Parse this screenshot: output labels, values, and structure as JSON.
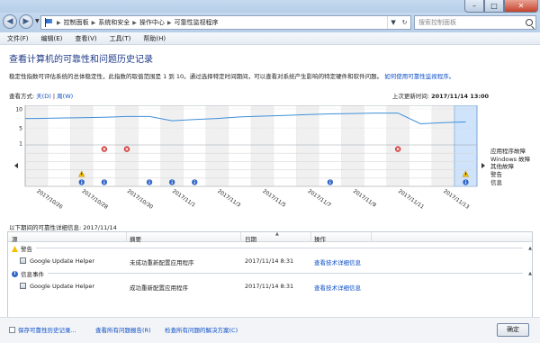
{
  "window": {
    "minimize": "–",
    "maximize": "□",
    "close": "✕"
  },
  "address": {
    "crumbs": [
      "控制面板",
      "系统和安全",
      "操作中心",
      "可靠性监视程序"
    ],
    "search_placeholder": "搜索控制面板",
    "icon": "flag-icon"
  },
  "menu": [
    "文件(F)",
    "编辑(E)",
    "查看(V)",
    "工具(T)",
    "帮助(H)"
  ],
  "page": {
    "title": "查看计算机的可靠性和问题历史记录",
    "description": "稳定性指数可评估系统的总体稳定性，此指数的取值范围是 1 到 10。通过选择特定时间期间，可以查看对系统产生影响的特定硬件和软件问题。",
    "help_link": "如何使用可靠性监视程序。",
    "view_label": "查看方式: ",
    "view_days": "天(D)",
    "view_sep": " | ",
    "view_weeks": "周(W)",
    "last_update_label": "上次更新时间: ",
    "last_update_value": "2017/11/14 13:00"
  },
  "chart_data": {
    "type": "line",
    "ylim": [
      1,
      10
    ],
    "yticks": [
      "10",
      "5",
      "1"
    ],
    "x": [
      "2017/10/26",
      "2017/10/27",
      "2017/10/28",
      "2017/10/29",
      "2017/10/30",
      "2017/10/31",
      "2017/11/1",
      "2017/11/2",
      "2017/11/3",
      "2017/11/4",
      "2017/11/5",
      "2017/11/6",
      "2017/11/7",
      "2017/11/8",
      "2017/11/9",
      "2017/11/10",
      "2017/11/11",
      "2017/11/12",
      "2017/11/13",
      "2017/11/14"
    ],
    "xticklabels": [
      "2017/10/26",
      "2017/10/28",
      "2017/10/30",
      "2017/11/1",
      "2017/11/3",
      "2017/11/5",
      "2017/11/7",
      "2017/11/9",
      "2017/11/11",
      "2017/11/13"
    ],
    "series": [
      {
        "values": [
          7.5,
          7.6,
          7.7,
          7.8,
          8.0,
          8.0,
          6.9,
          7.2,
          7.5,
          7.9,
          8.1,
          8.3,
          8.5,
          8.7,
          8.8,
          8.9,
          8.9,
          6.1,
          6.4,
          6.6
        ]
      }
    ],
    "selected": "2017/11/14",
    "rows": [
      "应用程序故障",
      "Windows 故障",
      "其他故障",
      "警告",
      "信息"
    ],
    "events": [
      {
        "date": "2017/10/29",
        "row": "应用程序故障",
        "icon": "error"
      },
      {
        "date": "2017/10/30",
        "row": "应用程序故障",
        "icon": "error"
      },
      {
        "date": "2017/11/11",
        "row": "应用程序故障",
        "icon": "error"
      },
      {
        "date": "2017/10/28",
        "row": "警告",
        "icon": "warning"
      },
      {
        "date": "2017/11/14",
        "row": "警告",
        "icon": "warning"
      },
      {
        "date": "2017/10/28",
        "row": "信息",
        "icon": "info"
      },
      {
        "date": "2017/10/29",
        "row": "信息",
        "icon": "info"
      },
      {
        "date": "2017/10/31",
        "row": "信息",
        "icon": "info"
      },
      {
        "date": "2017/11/1",
        "row": "信息",
        "icon": "info"
      },
      {
        "date": "2017/11/2",
        "row": "信息",
        "icon": "info"
      },
      {
        "date": "2017/11/8",
        "row": "信息",
        "icon": "info"
      },
      {
        "date": "2017/11/14",
        "row": "信息",
        "icon": "info"
      }
    ],
    "grid": true
  },
  "details": {
    "caption": "以下期间的可靠性详细信息: 2017/11/14",
    "columns": [
      "源",
      "摘要",
      "日期",
      "操作"
    ],
    "groups": [
      {
        "label": "警告",
        "icon": "warning",
        "rows": [
          {
            "source": "Google Update Helper",
            "summary": "未成功重新配置应用程序",
            "date": "2017/11/14 8:31",
            "action": "查看技术详细信息"
          }
        ]
      },
      {
        "label": "信息事件",
        "icon": "info",
        "rows": [
          {
            "source": "Google Update Helper",
            "summary": "成功重新配置应用程序",
            "date": "2017/11/14 8:31",
            "action": "查看技术详细信息"
          }
        ]
      }
    ]
  },
  "bottom": {
    "links": [
      "保存可靠性历史记录...",
      "查看所有问题报告(R)",
      "检查所有问题的解决方案(C)"
    ],
    "ok": "确定"
  },
  "colors": {
    "line": "#3f8fd8",
    "selected_band": "#cfe3fb",
    "error": "#d23b3b",
    "warning": "#f5c000",
    "info": "#3468c8",
    "link": "#0c4ec7"
  }
}
